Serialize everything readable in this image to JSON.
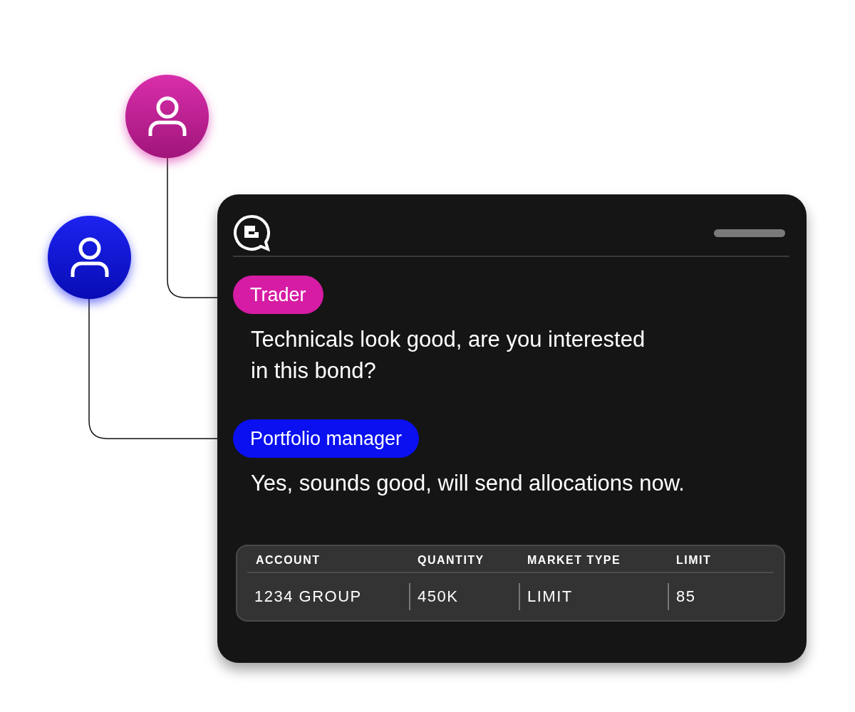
{
  "messages": [
    {
      "sender": "Trader",
      "color": "#d61ca4",
      "lines": [
        "Technicals look good, are you interested",
        "in this bond?"
      ]
    },
    {
      "sender": "Portfolio manager",
      "color": "#0a10f0",
      "lines": [
        "Yes, sounds good, will send allocations now."
      ]
    }
  ],
  "table": {
    "columns": [
      "ACCOUNT",
      "QUANTITY",
      "MARKET TYPE",
      "LIMIT"
    ],
    "rows": [
      [
        "1234 GROUP",
        "450K",
        "LIMIT",
        "85"
      ]
    ]
  }
}
